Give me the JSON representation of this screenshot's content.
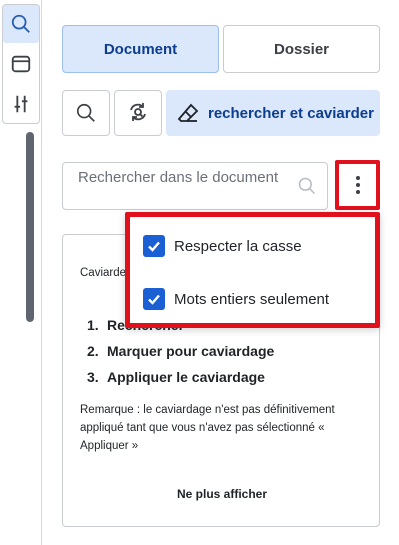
{
  "colors": {
    "accent": "#1a5fd3",
    "accent_light": "#dbe8fb",
    "accent_text": "#0c3d8f",
    "highlight": "#e0101d"
  },
  "rail": {
    "items": [
      {
        "name": "search-icon",
        "active": true
      },
      {
        "name": "panel-icon",
        "active": false
      },
      {
        "name": "sliders-icon",
        "active": false
      }
    ]
  },
  "tabs": [
    {
      "label": "Document",
      "selected": true
    },
    {
      "label": "Dossier",
      "selected": false
    }
  ],
  "tools": {
    "search_icon": "search-icon",
    "replace_icon": "search-refresh-icon",
    "redact_icon": "eraser-icon",
    "redact_label": "rechercher et caviarder"
  },
  "search": {
    "placeholder": "Rechercher dans le document",
    "value": ""
  },
  "options_menu": {
    "items": [
      {
        "label": "Respecter la casse",
        "checked": true
      },
      {
        "label": "Mots entiers seulement",
        "checked": true
      }
    ]
  },
  "card": {
    "intro": "Caviardez les informations sensibles en trois étapes :",
    "steps": [
      "Rechercher",
      "Marquer pour caviardage",
      "Appliquer le caviardage"
    ],
    "note": "Remarque : le caviardage n'est pas définitivement appliqué tant que vous n'avez pas sélectionné « Appliquer »",
    "dismiss": "Ne plus afficher"
  }
}
